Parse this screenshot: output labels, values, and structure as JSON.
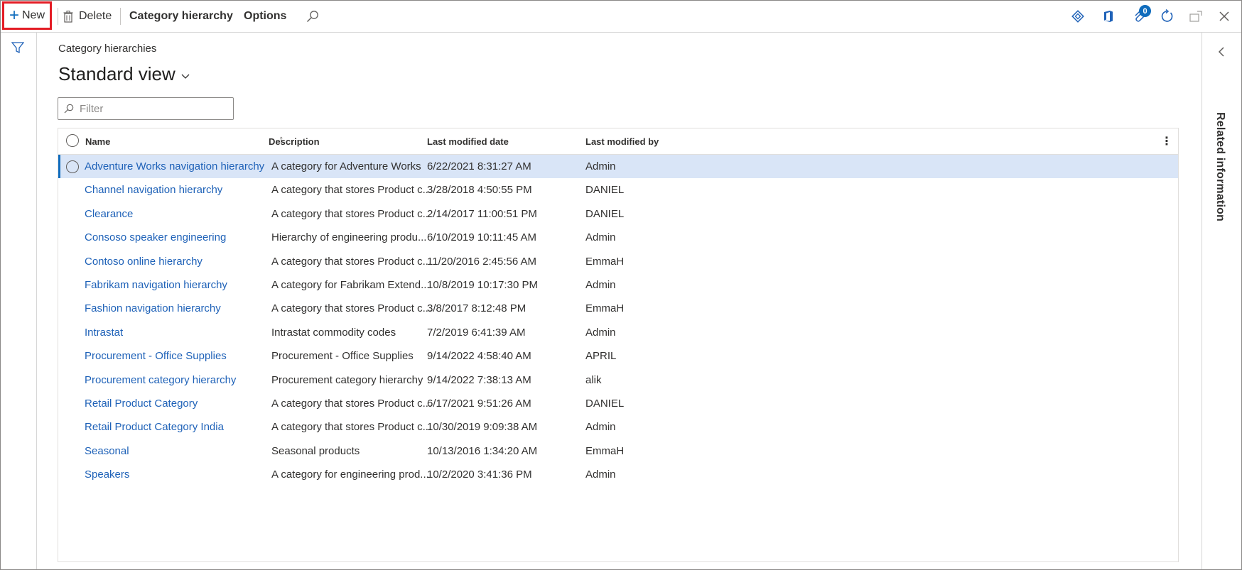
{
  "toolbar": {
    "new_label": "New",
    "delete_label": "Delete",
    "category_hierarchy_label": "Category hierarchy",
    "options_label": "Options",
    "notification_count": "0"
  },
  "breadcrumb": "Category hierarchies",
  "view_title": "Standard view",
  "filter": {
    "placeholder": "Filter",
    "value": ""
  },
  "grid": {
    "columns": [
      "Name",
      "Description",
      "Last modified date",
      "Last modified by"
    ],
    "rows": [
      {
        "name": "Adventure Works navigation hierarchy",
        "description": "A category for Adventure Works",
        "date": "6/22/2021 8:31:27 AM",
        "by": "Admin"
      },
      {
        "name": "Channel navigation hierarchy",
        "description": "A category that stores Product c...",
        "date": "3/28/2018 4:50:55 PM",
        "by": "DANIEL"
      },
      {
        "name": "Clearance",
        "description": "A category that stores Product c...",
        "date": "2/14/2017 11:00:51 PM",
        "by": "DANIEL"
      },
      {
        "name": "Consoso speaker engineering",
        "description": "Hierarchy of engineering produ...",
        "date": "6/10/2019 10:11:45 AM",
        "by": "Admin"
      },
      {
        "name": "Contoso online hierarchy",
        "description": "A category that stores Product c...",
        "date": "11/20/2016 2:45:56 AM",
        "by": "EmmaH"
      },
      {
        "name": "Fabrikam navigation hierarchy",
        "description": "A category for Fabrikam Extend...",
        "date": "10/8/2019 10:17:30 PM",
        "by": "Admin"
      },
      {
        "name": "Fashion navigation hierarchy",
        "description": "A category that stores Product c...",
        "date": "3/8/2017 8:12:48 PM",
        "by": "EmmaH"
      },
      {
        "name": "Intrastat",
        "description": "Intrastat commodity codes",
        "date": "7/2/2019 6:41:39 AM",
        "by": "Admin"
      },
      {
        "name": "Procurement - Office Supplies",
        "description": "Procurement - Office Supplies",
        "date": "9/14/2022 4:58:40 AM",
        "by": "APRIL"
      },
      {
        "name": "Procurement category hierarchy",
        "description": "Procurement category hierarchy",
        "date": "9/14/2022 7:38:13 AM",
        "by": "alik"
      },
      {
        "name": "Retail Product Category",
        "description": "A category that stores Product c...",
        "date": "6/17/2021 9:51:26 AM",
        "by": "DANIEL"
      },
      {
        "name": "Retail Product Category India",
        "description": "A category that stores Product c...",
        "date": "10/30/2019 9:09:38 AM",
        "by": "Admin"
      },
      {
        "name": "Seasonal",
        "description": "Seasonal products",
        "date": "10/13/2016 1:34:20 AM",
        "by": "EmmaH"
      },
      {
        "name": "Speakers",
        "description": "A category for engineering prod...",
        "date": "10/2/2020 3:41:36 PM",
        "by": "Admin"
      }
    ]
  },
  "related_pane": {
    "label": "Related information"
  },
  "colors": {
    "accent": "#0f6cbd",
    "highlight": "#e31c25",
    "selected_row": "#d9e5f7",
    "link": "#1f62b8"
  },
  "icons": [
    "plus-icon",
    "trash-icon",
    "search-icon",
    "diamond-icon",
    "office-icon",
    "attachment-icon",
    "refresh-icon",
    "open-new-window-icon",
    "close-icon",
    "filter-icon",
    "chevron-left-icon",
    "chevron-down-icon",
    "more-vertical-icon",
    "sort-ascending-icon"
  ]
}
